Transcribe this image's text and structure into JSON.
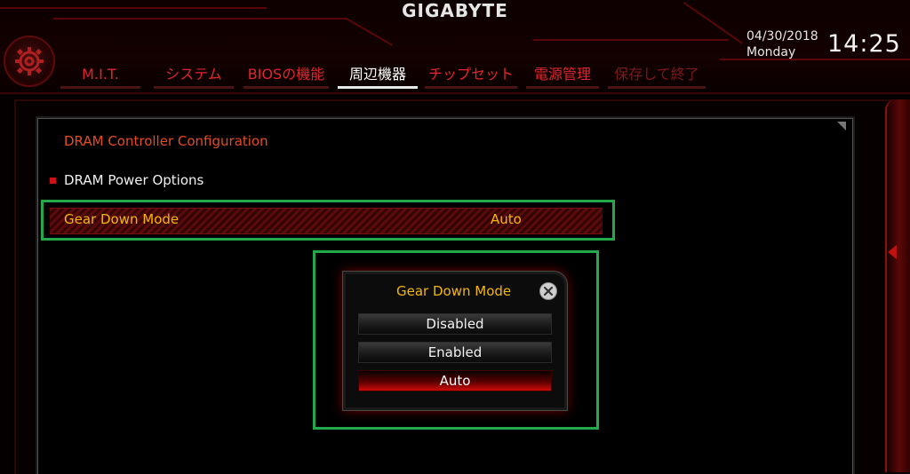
{
  "brand": "GIGABYTE",
  "datetime": {
    "date": "04/30/2018",
    "weekday": "Monday",
    "time": "14:25"
  },
  "nav": {
    "tabs": [
      {
        "label": "M.I.T."
      },
      {
        "label": "システム"
      },
      {
        "label": "BIOSの機能"
      },
      {
        "label": "周辺機器",
        "active": true
      },
      {
        "label": "チップセット"
      },
      {
        "label": "電源管理"
      },
      {
        "label": "保存して終了"
      }
    ]
  },
  "main": {
    "section_title": "DRAM Controller Configuration",
    "power_options_label": "DRAM Power Options",
    "gear_down": {
      "label": "Gear Down Mode",
      "value": "Auto"
    }
  },
  "popup": {
    "title": "Gear Down Mode",
    "options": [
      "Disabled",
      "Enabled",
      "Auto"
    ],
    "selected": "Auto"
  },
  "colors": {
    "accent_red": "#e0262c",
    "highlight_yellow": "#f5b800",
    "annotation_green": "#22a94b"
  },
  "icons": [
    "gear-icon",
    "close-icon",
    "bullet-icon",
    "scroll-arrow-icon"
  ]
}
